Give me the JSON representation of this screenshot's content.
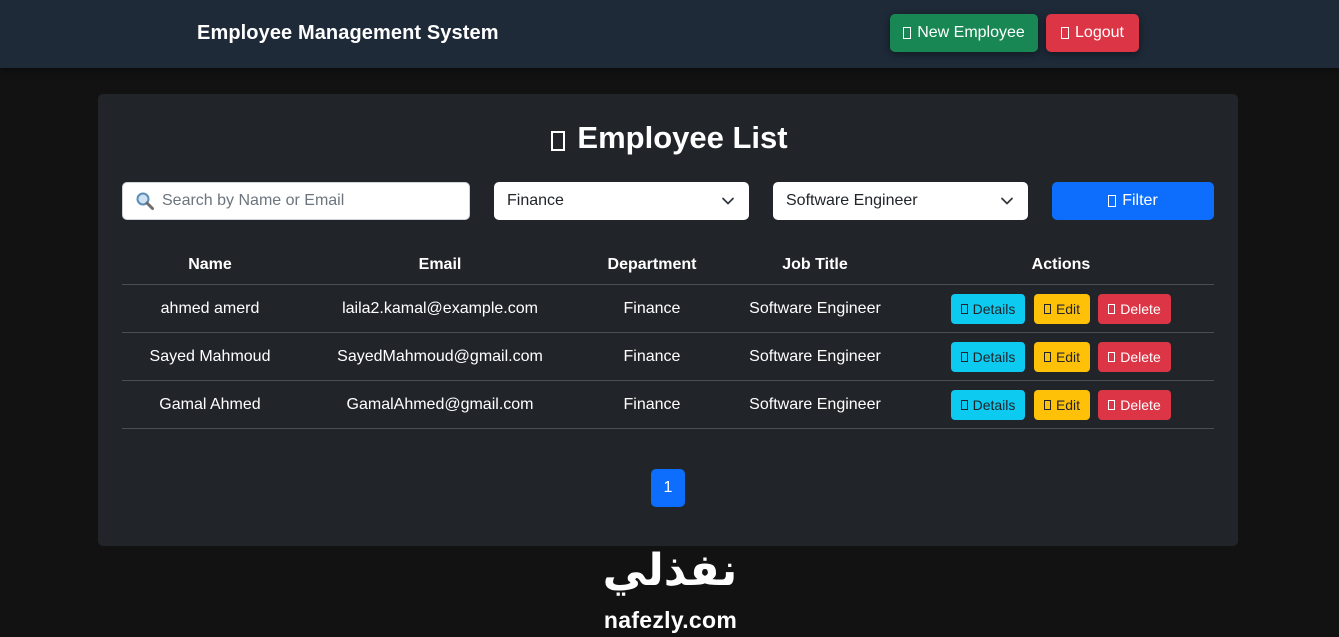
{
  "app": {
    "brand": "Employee Management System"
  },
  "nav": {
    "new_employee": "New Employee",
    "logout": "Logout"
  },
  "page": {
    "title": "Employee List"
  },
  "filters": {
    "search_placeholder": "Search by Name or Email",
    "search_value": "",
    "department": "Finance",
    "job_title": "Software Engineer",
    "filter_button": "Filter"
  },
  "table": {
    "headers": {
      "name": "Name",
      "email": "Email",
      "department": "Department",
      "job_title": "Job Title",
      "actions": "Actions"
    },
    "rows": [
      {
        "name": "ahmed amerd",
        "email": "laila2.kamal@example.com",
        "department": "Finance",
        "job_title": "Software Engineer"
      },
      {
        "name": "Sayed Mahmoud",
        "email": "SayedMahmoud@gmail.com",
        "department": "Finance",
        "job_title": "Software Engineer"
      },
      {
        "name": "Gamal Ahmed",
        "email": "GamalAhmed@gmail.com",
        "department": "Finance",
        "job_title": "Software Engineer"
      }
    ],
    "actions": {
      "details": "Details",
      "edit": "Edit",
      "delete": "Delete"
    }
  },
  "pagination": {
    "current_page": "1"
  },
  "watermark": {
    "arabic": "نفذلي",
    "latin": "nafezly.com"
  },
  "colors": {
    "navbar": "#1e2a38",
    "card": "#212529",
    "primary": "#0d6efd",
    "success": "#198754",
    "danger": "#dc3545",
    "info": "#0dcaf0",
    "warning": "#ffc107"
  }
}
